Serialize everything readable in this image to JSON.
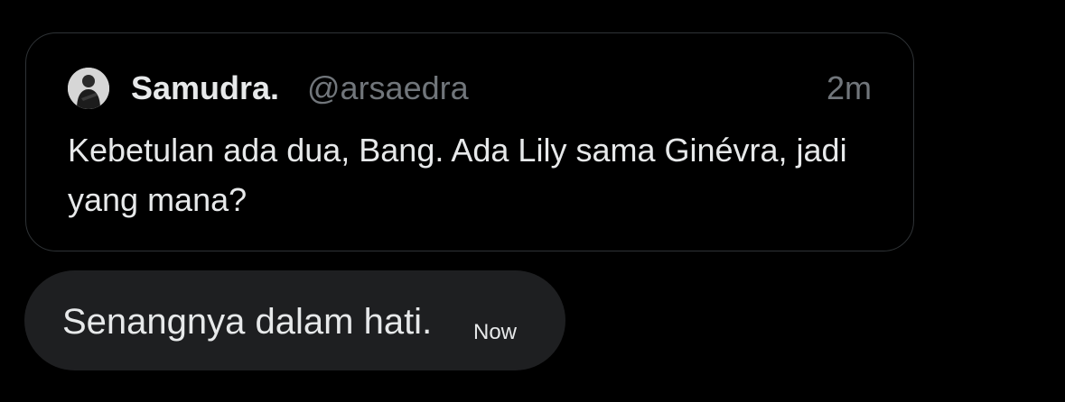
{
  "quoted_post": {
    "author_name": "Samudra.",
    "author_handle": "@arsaedra",
    "time": "2m",
    "text": "Kebetulan ada dua, Bang. Ada Lily sama Ginévra, jadi yang mana?",
    "avatar_icon": "user-avatar"
  },
  "message": {
    "text": "Senangnya dalam hati.",
    "time": "Now"
  },
  "colors": {
    "background": "#000000",
    "text_primary": "#e7e9ea",
    "text_secondary": "#71767b",
    "border": "#2f3336",
    "bubble": "#1e1f21"
  }
}
